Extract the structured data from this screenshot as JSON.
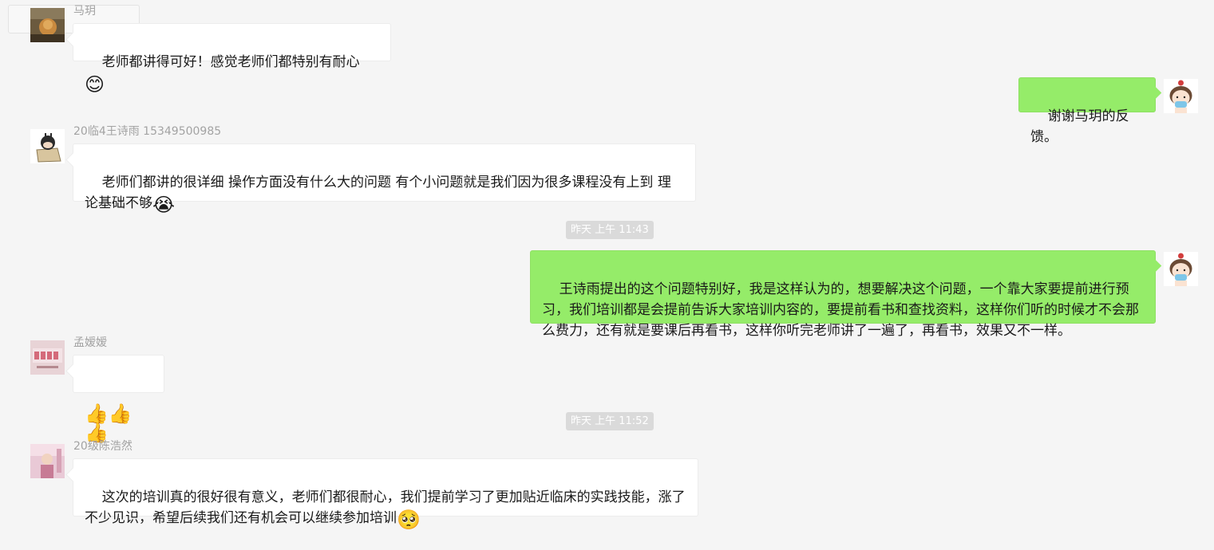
{
  "messages": [
    {
      "sender": "马玥",
      "text": "老师都讲得可好！感觉老师们都特别有耐心",
      "emoji": "😊",
      "emoji_icon": "smile-emoji-icon"
    },
    {
      "text": "谢谢马玥的反馈。"
    },
    {
      "sender": "20临4王诗雨 15349500985",
      "text": "老师们都讲的很详细 操作方面没有什么大的问题 有个小问题就是我们因为很多课程没有上到 理论基础不够",
      "emoji": "😭",
      "emoji_icon": "crying-emoji-icon"
    },
    {
      "timestamp": "昨天 上午 11:43"
    },
    {
      "text": "王诗雨提出的这个问题特别好，我是这样认为的，想要解决这个问题，一个靠大家要提前进行预习，我们培训都是会提前告诉大家培训内容的，要提前看书和查找资料，这样你们听的时候才不会那么费力，还有就是要课后再看书，这样你听完老师讲了一遍了，再看书，效果又不一样。"
    },
    {
      "sender": "孟嫒嫒",
      "emoji": "👍👍👍",
      "emoji_icon": "thumbs-up-emoji-icon"
    },
    {
      "timestamp": "昨天 上午 11:52"
    },
    {
      "sender": "20级陈浩然",
      "text": "这次的培训真的很好很有意义，老师们都很耐心，我们提前学习了更加贴近临床的实践技能，涨了不少见识，希望后续我们还有机会可以继续参加培训",
      "emoji": "🥺",
      "emoji_icon": "pleading-emoji-icon"
    }
  ],
  "avatars": {
    "ma_yue": "avatar-photo-icon",
    "self": "cartoon-girl-avatar-icon",
    "wang_shiyu": "cartoon-box-avatar-icon",
    "meng_aiai": "avatar-2021-icon",
    "chen_haoran": "avatar-pink-photo-icon"
  },
  "colors": {
    "background": "#f5f5f5",
    "incoming_bubble": "#ffffff",
    "outgoing_bubble": "#95ec69",
    "sender_name": "#a3a3a3",
    "timestamp_bg": "#dadada"
  }
}
